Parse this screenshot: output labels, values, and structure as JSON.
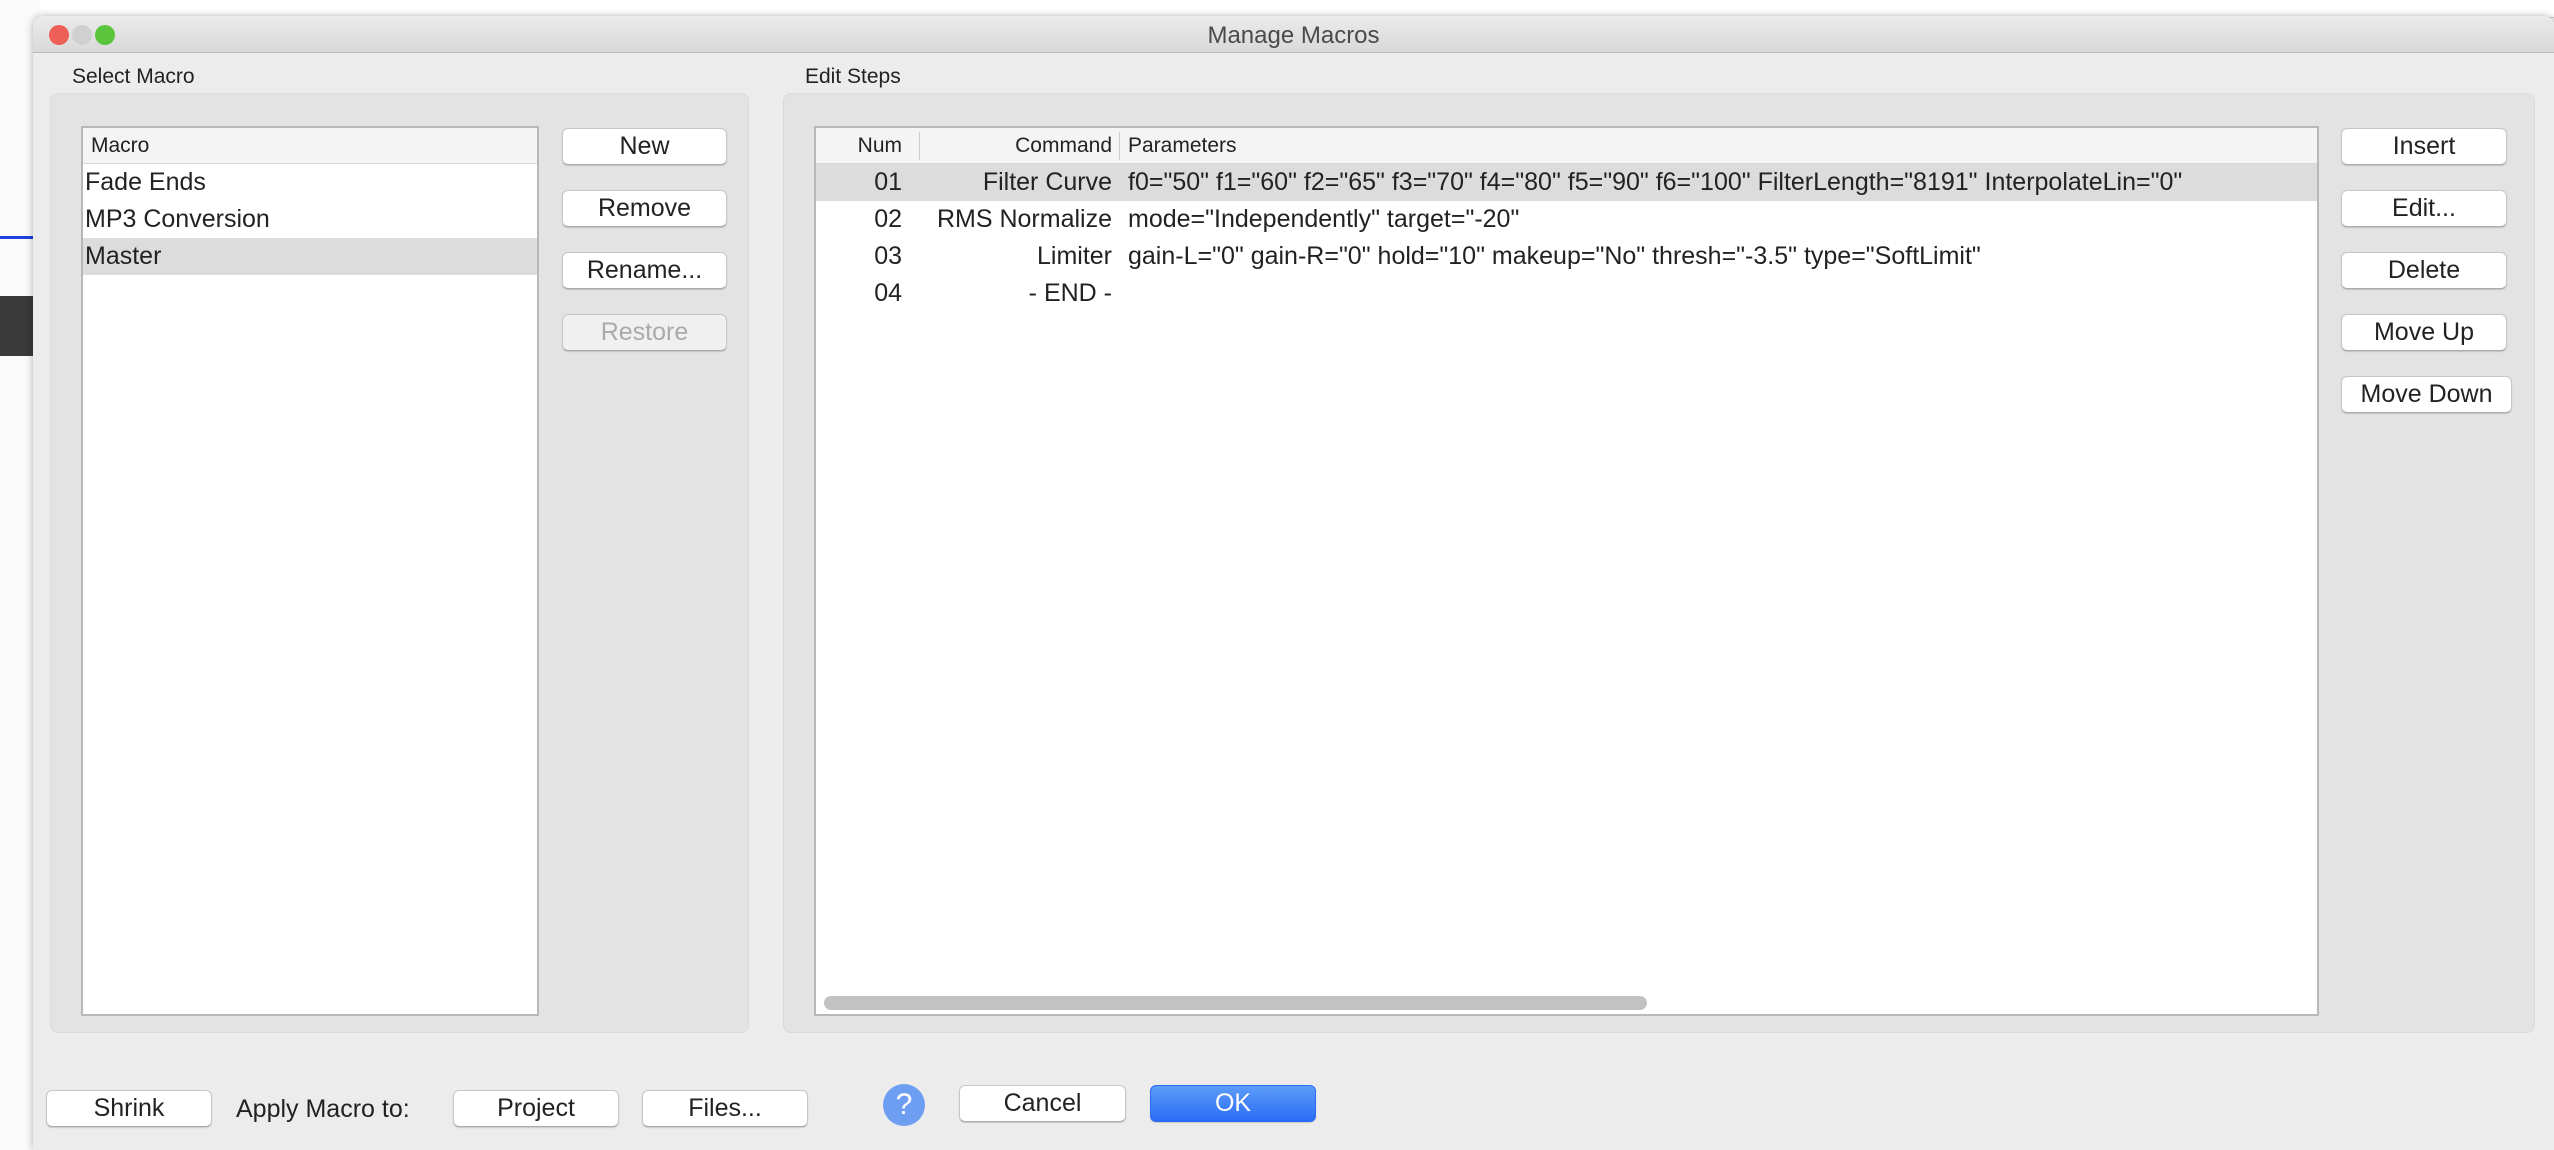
{
  "window": {
    "title": "Manage Macros"
  },
  "select_macro": {
    "label": "Select Macro",
    "column": "Macro",
    "items": [
      "Fade Ends",
      "MP3 Conversion",
      "Master"
    ],
    "selected": "Master",
    "buttons": {
      "new": "New",
      "remove": "Remove",
      "rename": "Rename...",
      "restore": "Restore"
    }
  },
  "edit_steps": {
    "label": "Edit Steps",
    "columns": {
      "num": "Num",
      "command": "Command",
      "parameters": "Parameters"
    },
    "rows": [
      {
        "num": "01",
        "command": "Filter Curve",
        "parameters": "f0=\"50\" f1=\"60\" f2=\"65\" f3=\"70\" f4=\"80\" f5=\"90\" f6=\"100\" FilterLength=\"8191\" InterpolateLin=\"0\""
      },
      {
        "num": "02",
        "command": "RMS Normalize",
        "parameters": "mode=\"Independently\" target=\"-20\""
      },
      {
        "num": "03",
        "command": "Limiter",
        "parameters": "gain-L=\"0\" gain-R=\"0\" hold=\"10\" makeup=\"No\" thresh=\"-3.5\" type=\"SoftLimit\""
      },
      {
        "num": "04",
        "command": "- END -",
        "parameters": ""
      }
    ],
    "buttons": {
      "insert": "Insert",
      "edit": "Edit...",
      "delete": "Delete",
      "move_up": "Move Up",
      "move_down": "Move Down"
    }
  },
  "footer": {
    "shrink": "Shrink",
    "apply_label": "Apply Macro to:",
    "project": "Project",
    "files": "Files...",
    "help": "?",
    "cancel": "Cancel",
    "ok": "OK"
  },
  "colors": {
    "accent": "#2a6cf5",
    "selection": "#dcdcdc",
    "close": "#ee5f57",
    "minimize": "#d0d0d0",
    "zoom": "#5ac43d"
  }
}
